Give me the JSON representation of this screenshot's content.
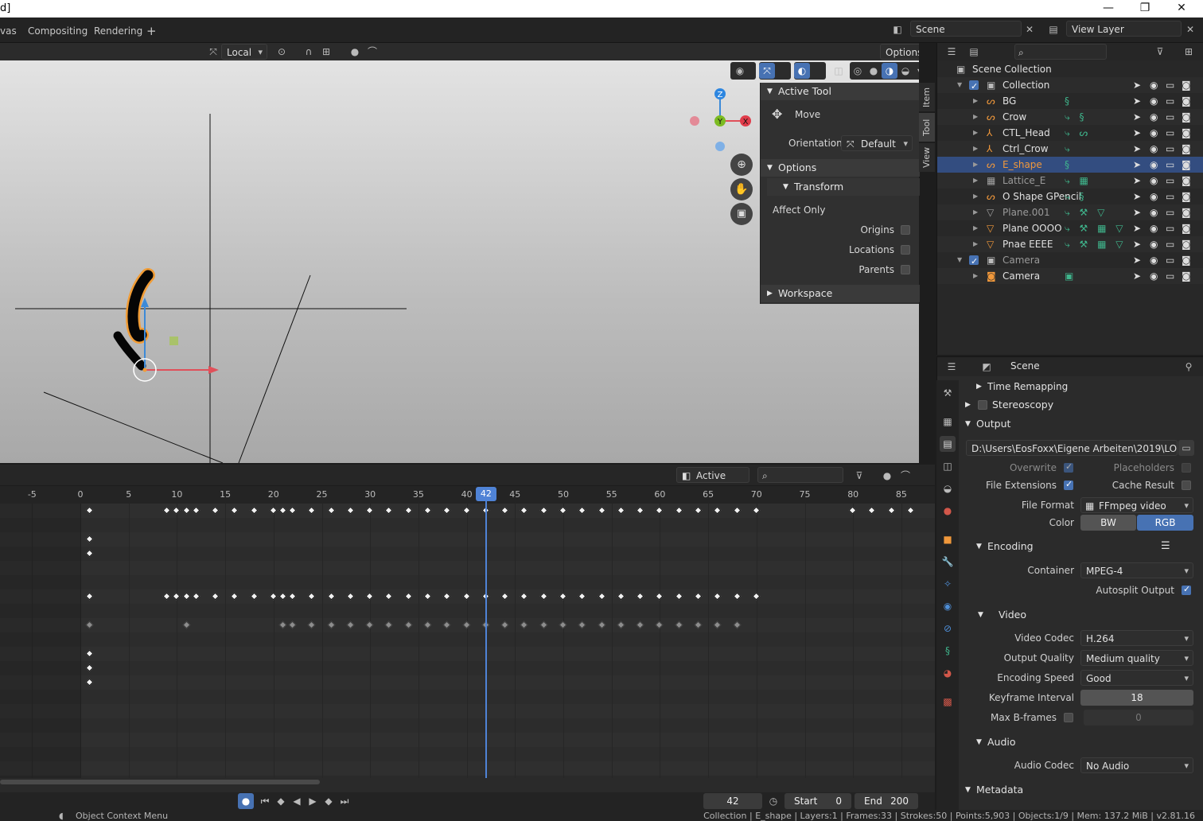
{
  "window": {
    "title": "d]",
    "minimize": "—",
    "maximize": "❐",
    "close": "✕"
  },
  "workspace_tabs": [
    "vas",
    "Compositing",
    "Rendering",
    "+"
  ],
  "scene_field": "Scene",
  "view_layer_field": "View Layer",
  "viewport": {
    "orientation_dd": "Local",
    "options_btn": "Options",
    "gizmo": {
      "z": "Z",
      "y": "Y",
      "x": "X"
    }
  },
  "npanel": {
    "tabs": [
      "Item",
      "Tool",
      "View"
    ],
    "active_tool": "Active Tool",
    "tool_name": "Move",
    "orientation_label": "Orientation",
    "orientation_value": "Default",
    "options": "Options",
    "transform": "Transform",
    "affect_only": "Affect Only",
    "origins": "Origins",
    "locations": "Locations",
    "parents": "Parents",
    "workspace": "Workspace"
  },
  "dopesheet": {
    "active_only": "Active Only",
    "ruler": [
      "-5",
      "0",
      "5",
      "10",
      "15",
      "20",
      "25",
      "30",
      "35",
      "40",
      "45",
      "50",
      "55",
      "60",
      "65",
      "70",
      "75",
      "80",
      "85"
    ],
    "current_frame": "42"
  },
  "playback": {
    "frame": "42",
    "start_label": "Start",
    "start": "0",
    "end_label": "End",
    "end": "200"
  },
  "status": {
    "left": "Object Context Menu",
    "right": "Collection | E_shape | Layers:1 | Frames:33 | Strokes:50 | Points:5,903 | Objects:1/9 | Mem: 137.2 MiB | v2.81.16"
  },
  "outliner": {
    "root": "Scene Collection",
    "items": [
      {
        "name": "Collection"
      },
      {
        "name": "BG"
      },
      {
        "name": "Crow"
      },
      {
        "name": "CTL_Head"
      },
      {
        "name": "Ctrl_Crow"
      },
      {
        "name": "E_shape"
      },
      {
        "name": "Lattice_E"
      },
      {
        "name": "O Shape GPencil"
      },
      {
        "name": "Plane.001"
      },
      {
        "name": "Plane OOOO"
      },
      {
        "name": "Pnae EEEE"
      },
      {
        "name": "Camera"
      },
      {
        "name": "Camera"
      }
    ]
  },
  "properties": {
    "header": "Scene",
    "time_remapping": "Time Remapping",
    "stereoscopy": "Stereoscopy",
    "output": "Output",
    "output_path": "D:\\Users\\EosFoxx\\Eigene Arbeiten\\2019\\LOGOTEST",
    "overwrite": "Overwrite",
    "placeholders": "Placeholders",
    "file_extensions": "File Extensions",
    "cache_result": "Cache Result",
    "file_format_label": "File Format",
    "file_format": "FFmpeg video",
    "color_label": "Color",
    "bw": "BW",
    "rgb": "RGB",
    "encoding": "Encoding",
    "container_label": "Container",
    "container": "MPEG-4",
    "autosplit": "Autosplit Output",
    "video": "Video",
    "video_codec_label": "Video Codec",
    "video_codec": "H.264",
    "output_quality_label": "Output Quality",
    "output_quality": "Medium quality",
    "encoding_speed_label": "Encoding Speed",
    "encoding_speed": "Good",
    "keyframe_interval_label": "Keyframe Interval",
    "keyframe_interval": "18",
    "max_bframes_label": "Max B-frames",
    "max_bframes": "0",
    "audio": "Audio",
    "audio_codec_label": "Audio Codec",
    "audio_codec": "No Audio",
    "metadata": "Metadata"
  }
}
